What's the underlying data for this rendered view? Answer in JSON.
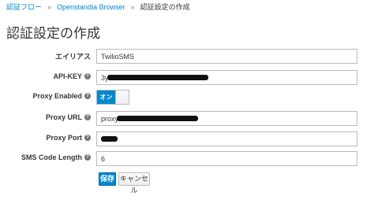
{
  "breadcrumb": {
    "items": [
      "認証フロー",
      "Openstandia Browser"
    ],
    "separator": "»",
    "current": "認証設定の作成"
  },
  "page": {
    "title": "認証設定の作成"
  },
  "form": {
    "alias": {
      "label": "エイリアス",
      "value": "TwilioSMS"
    },
    "api_key": {
      "label": "API-KEY",
      "value": "3y"
    },
    "proxy_enabled": {
      "label": "Proxy Enabled",
      "toggle_on_label": "オン",
      "state": "on"
    },
    "proxy_url": {
      "label": "Proxy URL",
      "value": "proxy"
    },
    "proxy_port": {
      "label": "Proxy Port",
      "value": ""
    },
    "sms_code_length": {
      "label": "SMS Code Length",
      "value": "6"
    }
  },
  "actions": {
    "save_label": "保存",
    "cancel_label": "キャンセル"
  },
  "icons": {
    "help": "question-circle-icon",
    "help_glyph": "?"
  },
  "colors": {
    "accent": "#0088ce",
    "text": "#363636",
    "border": "#bbbbbb",
    "redaction": "#111111"
  }
}
